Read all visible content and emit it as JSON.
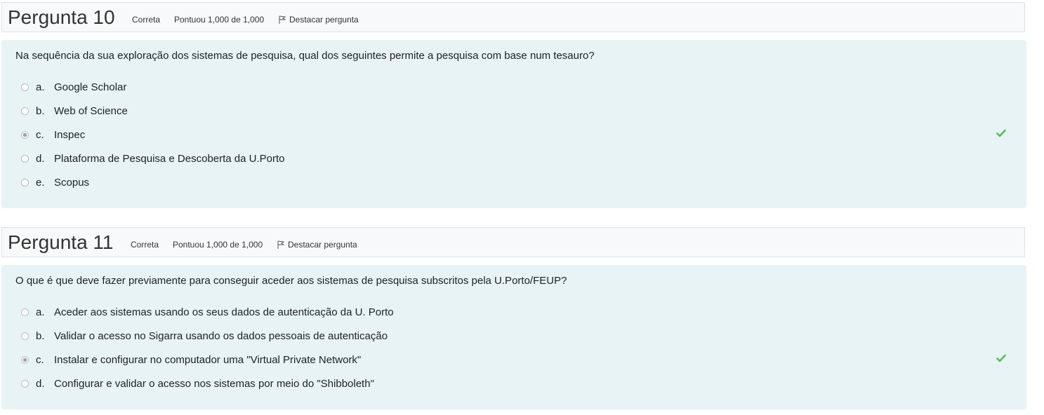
{
  "questions": [
    {
      "title": "Pergunta 10",
      "status": "Correta",
      "score": "Pontuou 1,000 de 1,000",
      "flag_label": "Destacar pergunta",
      "text": "Na sequência da sua exploração dos sistemas de pesquisa, qual dos seguintes permite a pesquisa com base num tesauro?",
      "answers": [
        {
          "letter": "a.",
          "text": "Google Scholar"
        },
        {
          "letter": "b.",
          "text": "Web of Science"
        },
        {
          "letter": "c.",
          "text": "Inspec"
        },
        {
          "letter": "d.",
          "text": "Plataforma de Pesquisa e Descoberta da U.Porto"
        },
        {
          "letter": "e.",
          "text": "Scopus"
        }
      ],
      "selected": "c.",
      "correct_mark": "check-icon"
    },
    {
      "title": "Pergunta 11",
      "status": "Correta",
      "score": "Pontuou 1,000 de 1,000",
      "flag_label": "Destacar pergunta",
      "text": "O que é que deve fazer previamente para conseguir aceder aos sistemas de pesquisa subscritos pela U.Porto/FEUP?",
      "answers": [
        {
          "letter": "a.",
          "text": "Aceder aos sistemas usando os seus dados de autenticação da U. Porto"
        },
        {
          "letter": "b.",
          "text": "Validar o acesso no Sigarra usando os dados pessoais de autenticação"
        },
        {
          "letter": "c.",
          "text": "Instalar e configurar no computador uma \"Virtual Private Network\""
        },
        {
          "letter": "d.",
          "text": "Configurar e validar o acesso nos sistemas por meio do \"Shibboleth\""
        }
      ],
      "selected": "c.",
      "correct_mark": "check-icon"
    }
  ],
  "colors": {
    "header_bg": "#f8f9fa",
    "body_bg": "#e7f3f5",
    "check": "#5cb85c"
  }
}
